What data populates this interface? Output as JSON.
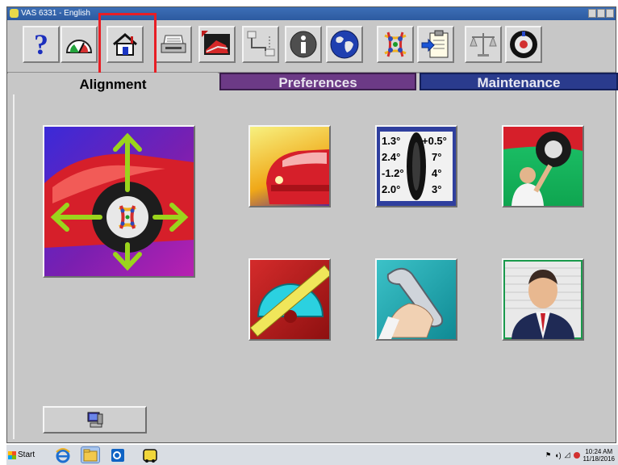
{
  "window": {
    "title": "VAS 6331 - English"
  },
  "toolbar": {
    "buttons": [
      {
        "name": "help",
        "icon": "question-mark-icon"
      },
      {
        "name": "gauge",
        "icon": "gauge-icon"
      },
      {
        "name": "home",
        "icon": "home-icon"
      },
      {
        "name": "print",
        "icon": "printer-icon"
      },
      {
        "name": "screen",
        "icon": "monitor-icon"
      },
      {
        "name": "network",
        "icon": "network-icon"
      },
      {
        "name": "info",
        "icon": "info-icon"
      },
      {
        "name": "globe",
        "icon": "globe-icon"
      },
      {
        "name": "alignment",
        "icon": "alignment-logo-icon"
      },
      {
        "name": "export",
        "icon": "clipboard-export-icon"
      },
      {
        "name": "scale",
        "icon": "scale-icon"
      },
      {
        "name": "wheel",
        "icon": "wheel-icon"
      }
    ],
    "help_label": "?",
    "accent_highlight": "#e81e25"
  },
  "tabs": [
    {
      "label": "Alignment",
      "active": true
    },
    {
      "label": "Preferences",
      "active": false
    },
    {
      "label": "Maintenance",
      "active": false
    }
  ],
  "tiles": {
    "main": {
      "icon": "car-wheel-alignment-icon"
    },
    "row1": [
      {
        "icon": "car-front-icon"
      },
      {
        "icon": "alignment-specs-icon",
        "values": [
          "1.3°",
          "2.4°",
          "-1.2°",
          "2.0°"
        ],
        "values_right": [
          "0.5°",
          "7°",
          "4°",
          "3°"
        ],
        "plus_sign": "+"
      },
      {
        "icon": "technician-tire-icon"
      }
    ],
    "row2": [
      {
        "icon": "protractor-icon"
      },
      {
        "icon": "wrench-hand-icon"
      },
      {
        "icon": "customer-profile-icon"
      }
    ]
  },
  "bottom_button": {
    "icon": "computer-icon"
  },
  "taskbar": {
    "start_label": "Start",
    "time": "10:24 AM",
    "date": "11/18/2016",
    "apps": [
      "ie-icon",
      "explorer-icon",
      "outlook-icon",
      "vas-app-icon"
    ]
  },
  "colors": {
    "preferences_tab": "#6c3a86",
    "maintenance_tab": "#2a3b8d",
    "window_bg": "#c7c7c7"
  }
}
